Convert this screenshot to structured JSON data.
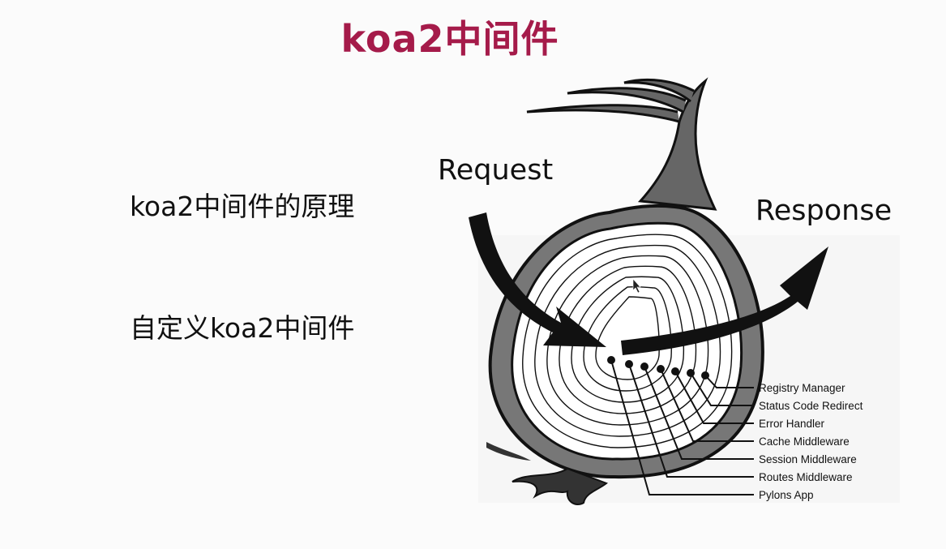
{
  "title": "koa2中间件",
  "bullets": [
    "koa2中间件的原理",
    "自定义koa2中间件"
  ],
  "diagram": {
    "request_label": "Request",
    "response_label": "Response",
    "layers": [
      "Registry Manager",
      "Status Code Redirect",
      "Error Handler",
      "Cache Middleware",
      "Session Middleware",
      "Routes Middleware",
      "Pylons App"
    ]
  }
}
